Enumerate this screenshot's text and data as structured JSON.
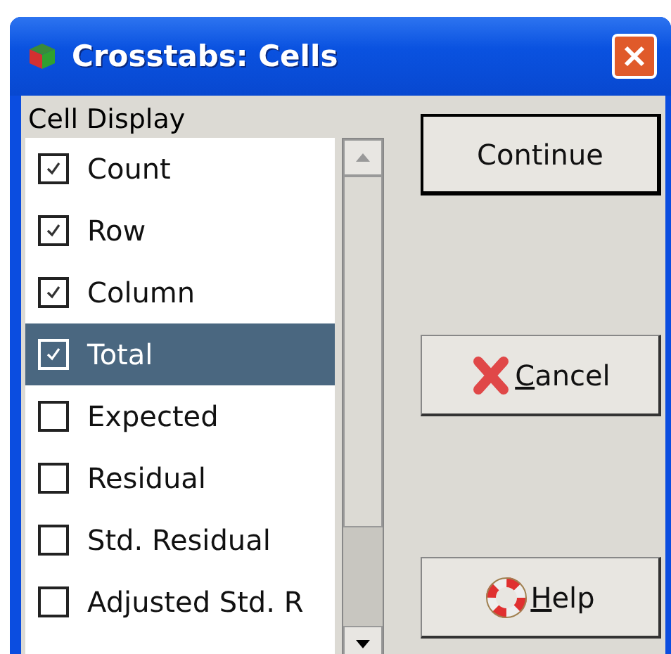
{
  "window": {
    "title": "Crosstabs: Cells"
  },
  "group": {
    "label": "Cell Display"
  },
  "items": [
    {
      "label": "Count",
      "checked": true,
      "selected": false
    },
    {
      "label": "Row",
      "checked": true,
      "selected": false
    },
    {
      "label": "Column",
      "checked": true,
      "selected": false
    },
    {
      "label": "Total",
      "checked": true,
      "selected": true
    },
    {
      "label": "Expected",
      "checked": false,
      "selected": false
    },
    {
      "label": "Residual",
      "checked": false,
      "selected": false
    },
    {
      "label": "Std. Residual",
      "checked": false,
      "selected": false
    },
    {
      "label": "Adjusted Std. R",
      "checked": false,
      "selected": false
    }
  ],
  "buttons": [
    {
      "kind": "continue",
      "label_rest": "Continue"
    },
    {
      "kind": "cancel",
      "access_key": "C",
      "label_rest": "ancel"
    },
    {
      "kind": "help",
      "access_key": "H",
      "label_rest": "elp"
    }
  ]
}
